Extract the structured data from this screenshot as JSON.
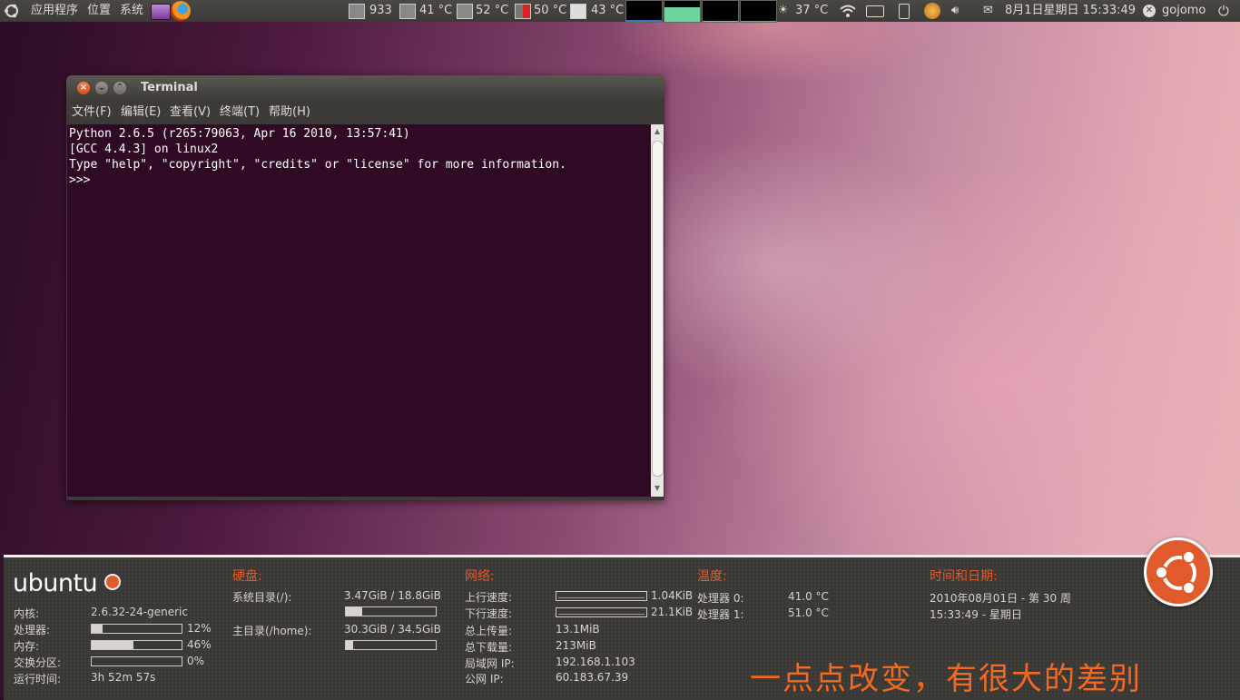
{
  "top_panel": {
    "menus": [
      "应用程序",
      "位置",
      "系统"
    ],
    "cpu_freq": "933",
    "temps": [
      "41 °C",
      "52 °C",
      "50 °C",
      "43 °C"
    ],
    "weather_temp": "37 °C",
    "datetime": "8月1日星期日 15:33:49",
    "username": "gojomo"
  },
  "terminal": {
    "title": "Terminal",
    "menu": [
      "文件(F)",
      "编辑(E)",
      "查看(V)",
      "终端(T)",
      "帮助(H)"
    ],
    "output": [
      "Python 2.6.5 (r265:79063, Apr 16 2010, 13:57:41)",
      "[GCC 4.4.3] on linux2",
      "Type \"help\", \"copyright\", \"credits\" or \"license\" for more information.",
      ">>>"
    ]
  },
  "info_panel": {
    "brand": "ubuntu",
    "system": {
      "kernel_label": "内核:",
      "kernel_value": "2.6.32-24-generic",
      "cpu_label": "处理器:",
      "cpu_percent": "12%",
      "cpu_fraction": 0.12,
      "mem_label": "内存:",
      "mem_percent": "46%",
      "mem_fraction": 0.46,
      "swap_label": "交换分区:",
      "swap_percent": "0%",
      "swap_fraction": 0.0,
      "uptime_label": "运行时间:",
      "uptime_value": "3h 52m 57s"
    },
    "disk": {
      "heading": "硬盘:",
      "root_label": "系统目录(/):",
      "root_usage": "3.47GiB / 18.8GiB",
      "root_fraction": 0.18,
      "home_label": "主目录(/home):",
      "home_usage": "30.3GiB / 34.5GiB",
      "home_fraction": 0.08
    },
    "network": {
      "heading": "网络:",
      "up_speed_label": "上行速度:",
      "up_speed_value": "1.04KiB",
      "down_speed_label": "下行速度:",
      "down_speed_value": "21.1KiB",
      "total_up_label": "总上传量:",
      "total_up_value": "13.1MiB",
      "total_down_label": "总下载量:",
      "total_down_value": "213MiB",
      "lan_ip_label": "局域网 IP:",
      "lan_ip_value": "192.168.1.103",
      "public_ip_label": "公网 IP:",
      "public_ip_value": "60.183.67.39"
    },
    "temperature": {
      "heading": "温度:",
      "cpu0_label": "处理器 0:",
      "cpu0_value": "41.0 °C",
      "cpu1_label": "处理器 1:",
      "cpu1_value": "51.0 °C"
    },
    "datetime": {
      "heading": "时间和日期:",
      "date_line": "2010年08月01日 - 第 30 周",
      "time_line": "15:33:49 - 星期日"
    }
  },
  "slogan": "一点点改变，有很大的差别",
  "colors": {
    "accent_orange": "#e05a2b",
    "terminal_bg": "#300a24",
    "panel_bg": "#3c3b37"
  }
}
